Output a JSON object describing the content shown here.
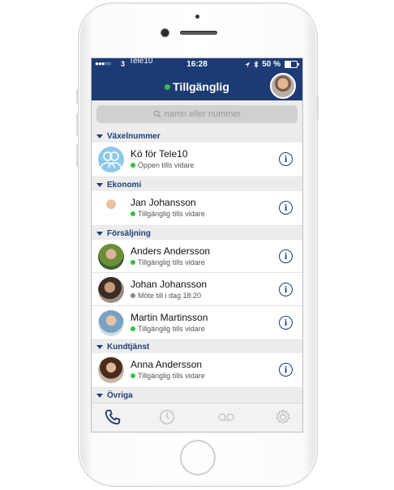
{
  "statusbar": {
    "signal": "●●●○○",
    "carrier": "3",
    "carrier_overlay": "Tele10",
    "time": "16:28",
    "battery": "50 %",
    "battery_level": 0.5
  },
  "header": {
    "status_label": "Tillgänglig",
    "status_color": "#2fc43d",
    "background": "#1c3b75"
  },
  "search": {
    "placeholder": "namn eller nummer"
  },
  "sections": [
    {
      "title": "Växelnummer"
    },
    {
      "title": "Ekonomi"
    },
    {
      "title": "Försäljning"
    },
    {
      "title": "Kundtjänst"
    },
    {
      "title": "Övriga"
    }
  ],
  "contacts": [
    {
      "name": "Kö för Tele10",
      "status": "Öppen tills vidare",
      "status_color": "green"
    },
    {
      "name": "Jan Johansson",
      "status": "Tillgänglig tills vidare",
      "status_color": "green"
    },
    {
      "name": "Anders Andersson",
      "status": "Tillgänglig tills vidare",
      "status_color": "green"
    },
    {
      "name": "Johan Johansson",
      "status": "Möte till i dag 18:20",
      "status_color": "gray"
    },
    {
      "name": "Martin Martinsson",
      "status": "Tillgänglig tills vidare",
      "status_color": "green"
    },
    {
      "name": "Anna Andersson",
      "status": "Tillgänglig tills vidare",
      "status_color": "green"
    }
  ],
  "info_glyph": "i",
  "tabbar": {
    "tabs": [
      {
        "icon": "phone-icon",
        "active": true
      },
      {
        "icon": "clock-icon",
        "active": false
      },
      {
        "icon": "voicemail-icon",
        "active": false
      },
      {
        "icon": "gear-icon",
        "active": false
      }
    ]
  }
}
